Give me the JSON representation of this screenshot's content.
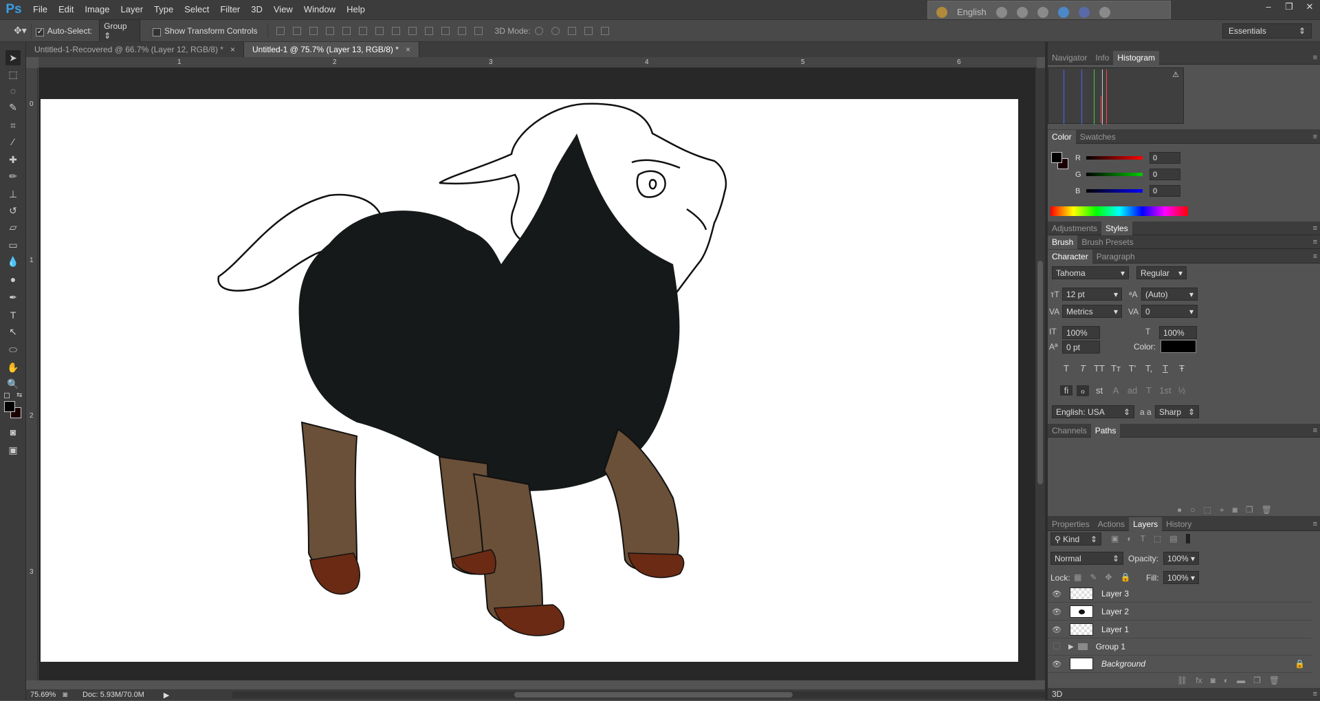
{
  "app": {
    "logo": "Ps"
  },
  "menu": [
    "File",
    "Edit",
    "Image",
    "Layer",
    "Type",
    "Select",
    "Filter",
    "3D",
    "View",
    "Window",
    "Help"
  ],
  "ime": {
    "language": "English"
  },
  "window_controls": [
    "–",
    "❐",
    "✕"
  ],
  "options": {
    "auto_select_label": "Auto-Select:",
    "auto_select_value": "Group",
    "show_transform_label": "Show Transform Controls",
    "mode3d_label": "3D Mode:",
    "workspace": "Essentials"
  },
  "tabs": [
    {
      "label": "Untitled-1-Recovered @ 66.7% (Layer 12, RGB/8) *",
      "active": false
    },
    {
      "label": "Untitled-1 @ 75.7% (Layer 13, RGB/8) *",
      "active": true
    }
  ],
  "ruler": {
    "top": [
      "1",
      "2",
      "3",
      "4",
      "5",
      "6"
    ],
    "left": [
      "0",
      "1",
      "2",
      "3"
    ]
  },
  "status": {
    "zoom": "75.69%",
    "doc": "Doc: 5.93M/70.0M"
  },
  "panels": {
    "group1_tabs": [
      "Navigator",
      "Info",
      "Histogram"
    ],
    "color_tabs": [
      "Color",
      "Swatches"
    ],
    "color": {
      "r": "0",
      "g": "0",
      "b": "0",
      "r_label": "R",
      "g_label": "G",
      "b_label": "B"
    },
    "adj_tabs": [
      "Adjustments",
      "Styles"
    ],
    "brush_tabs": [
      "Brush",
      "Brush Presets"
    ],
    "char_tabs": [
      "Character",
      "Paragraph"
    ],
    "character": {
      "font": "Tahoma",
      "style": "Regular",
      "size": "12 pt",
      "leading": "(Auto)",
      "kerning": "Metrics",
      "tracking": "0",
      "vscale": "100%",
      "hscale": "100%",
      "baseline": "0 pt",
      "color_label": "Color:",
      "language": "English: USA",
      "aa_label": "a a",
      "antialias": "Sharp",
      "type_buttons": [
        "T",
        "T",
        "TT",
        "Tт",
        "T'",
        "T,",
        "T",
        "Ŧ"
      ],
      "opentype_buttons": [
        "fi",
        "ℴ",
        "st",
        "A",
        "ad",
        "T",
        "1st",
        "½"
      ]
    },
    "paths_tabs": [
      "Channels",
      "Paths"
    ],
    "layer_tabs": [
      "Properties",
      "Actions",
      "Layers",
      "History"
    ],
    "layers": {
      "filter": "Kind",
      "blend": "Normal",
      "opacity_label": "Opacity:",
      "opacity": "100%",
      "lock_label": "Lock:",
      "fill_label": "Fill:",
      "fill": "100%",
      "items": [
        {
          "name": "Layer 3"
        },
        {
          "name": "Layer 2"
        },
        {
          "name": "Layer 1"
        },
        {
          "name": "Group 1"
        },
        {
          "name": "Background"
        }
      ]
    },
    "bottom_tab": "3D"
  },
  "colors": {
    "fur_black": "#161919",
    "legs": "#6a5038",
    "hooves": "#6a2a14"
  }
}
